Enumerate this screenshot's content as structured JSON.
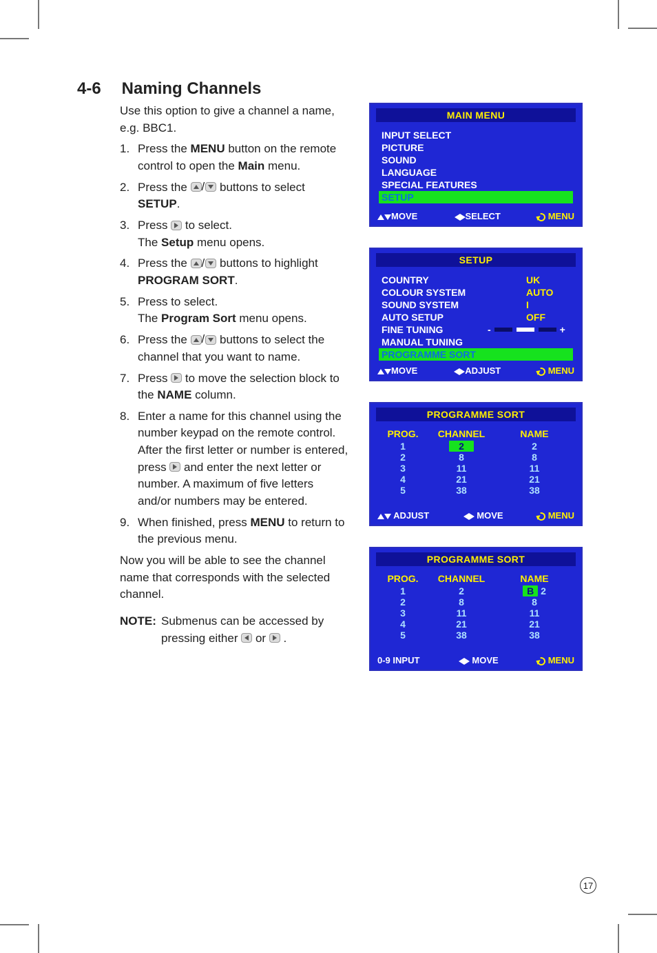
{
  "section": {
    "number": "4-6",
    "title": "Naming Channels"
  },
  "intro": "Use this option to give a channel a name, e.g. BBC1.",
  "steps": [
    {
      "n": "1.",
      "pre": "Press the ",
      "b1": "MENU",
      "mid": " button on the remote control to open the ",
      "b2": "Main",
      "post": " menu."
    },
    {
      "n": "2.",
      "pre": "Press the ",
      "icon": "ud",
      "mid2": " buttons to select ",
      "b1": "SETUP",
      "post": "."
    },
    {
      "n": "3.",
      "pre": "Press ",
      "icon": "r",
      "mid2": " to select.",
      "line2a": "The ",
      "line2b": "Setup",
      "line2c": " menu opens."
    },
    {
      "n": "4.",
      "pre": "Press the ",
      "icon": "ud",
      "mid2": " buttons to highlight ",
      "b1": "PROGRAM SORT",
      "post": "."
    },
    {
      "n": "5.",
      "pre": "Press to select.",
      "line2a": "The ",
      "line2b": "Program Sort",
      "line2c": " menu opens."
    },
    {
      "n": "6.",
      "pre": "Press the ",
      "icon": "ud",
      "mid2": " buttons to select the channel that you want to name."
    },
    {
      "n": "7.",
      "pre": "Press ",
      "icon": "r",
      "mid2": " to move the selection block to the ",
      "b1": "NAME",
      "post": " column."
    },
    {
      "n": "8.",
      "pre": "Enter a name for this channel using the number keypad on the remote control. After the first letter or number is entered, press ",
      "icon": "r",
      "mid2": " and enter the next letter or number. A maximum of five letters and/or numbers may be entered."
    },
    {
      "n": "9.",
      "pre": "When finished, press ",
      "b1": "MENU",
      "post": " to return to the previous menu."
    }
  ],
  "now": "Now you will be able to see the channel name that corresponds with the selected channel.",
  "note": {
    "label": "NOTE:",
    "pre": "Submenus can be accessed by pressing either ",
    "mid": " or ",
    "post": "."
  },
  "panels": {
    "main": {
      "title": "MAIN MENU",
      "items": [
        "INPUT SELECT",
        "PICTURE",
        "SOUND",
        "LANGUAGE",
        "SPECIAL FEATURES",
        "SETUP"
      ],
      "highlight": 5,
      "footer": {
        "f1": "MOVE",
        "f2": "SELECT",
        "f3": "MENU"
      }
    },
    "setup": {
      "title": "SETUP",
      "rows": [
        {
          "k": "COUNTRY",
          "v": "UK"
        },
        {
          "k": "COLOUR SYSTEM",
          "v": "AUTO"
        },
        {
          "k": "SOUND SYSTEM",
          "v": "I"
        },
        {
          "k": "AUTO SETUP",
          "v": "OFF"
        },
        {
          "k": "FINE TUNING",
          "bar": true
        },
        {
          "k": "MANUAL TUNING"
        },
        {
          "k": "PROGRAMME SORT",
          "hl": true
        }
      ],
      "footer": {
        "f1": "MOVE",
        "f2": "ADJUST",
        "f3": "MENU"
      }
    },
    "ps1": {
      "title": "PROGRAMME SORT",
      "headers": [
        "PROG.",
        "CHANNEL",
        "NAME"
      ],
      "rows": [
        {
          "p": "1",
          "c": "2",
          "n": "2",
          "hl": "c"
        },
        {
          "p": "2",
          "c": "8",
          "n": "8"
        },
        {
          "p": "3",
          "c": "11",
          "n": "11"
        },
        {
          "p": "4",
          "c": "21",
          "n": "21"
        },
        {
          "p": "5",
          "c": "38",
          "n": "38"
        }
      ],
      "footer": {
        "f1": "ADJUST",
        "f2": "MOVE",
        "f3": "MENU",
        "arrows1": "ud"
      }
    },
    "ps2": {
      "title": "PROGRAMME SORT",
      "headers": [
        "PROG.",
        "CHANNEL",
        "NAME"
      ],
      "rows": [
        {
          "p": "1",
          "c": "2",
          "n": "2",
          "hl": "n",
          "hl_pre": "B"
        },
        {
          "p": "2",
          "c": "8",
          "n": "8"
        },
        {
          "p": "3",
          "c": "11",
          "n": "11"
        },
        {
          "p": "4",
          "c": "21",
          "n": "21"
        },
        {
          "p": "5",
          "c": "38",
          "n": "38"
        }
      ],
      "footer": {
        "f1": "0-9 INPUT",
        "f2": "MOVE",
        "f3": "MENU",
        "noarrow1": true
      }
    }
  },
  "page_number": "17"
}
